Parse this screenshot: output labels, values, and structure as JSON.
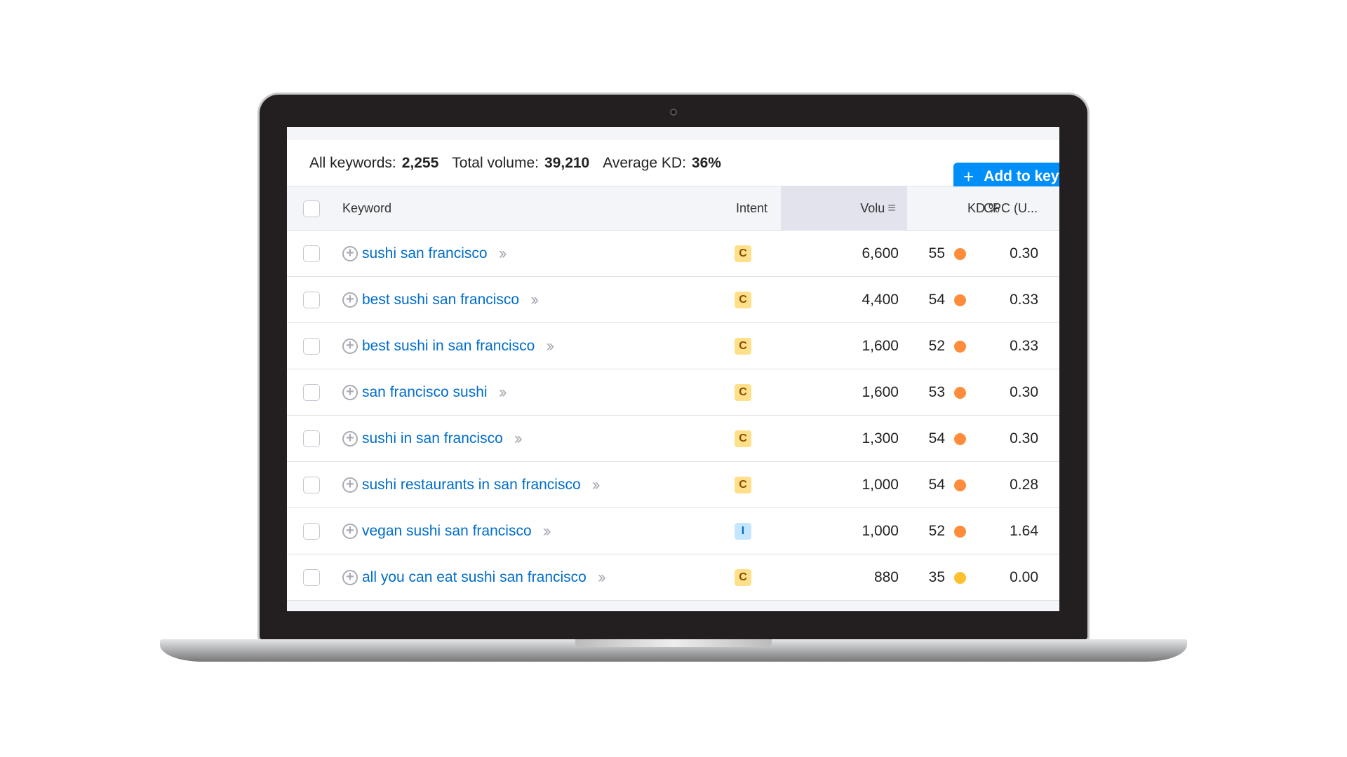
{
  "summary": {
    "all_label": "All keywords:",
    "all_value": "2,255",
    "vol_label": "Total volume:",
    "vol_value": "39,210",
    "kd_label": "Average KD:",
    "kd_value": "36%"
  },
  "add_button": {
    "icon": "plus-icon",
    "label": "Add to keyword list"
  },
  "columns": {
    "keyword": "Keyword",
    "intent": "Intent",
    "volume": "Volu",
    "kd": "KD %",
    "cpc": "CPC (U..."
  },
  "colors": {
    "link": "#006dca",
    "button": "#008ff8",
    "kd_orange": "#ff8c3b",
    "kd_yellow": "#ffc02e",
    "intent_c_bg": "#ffe08a",
    "intent_c_fg": "#8a4b00",
    "intent_i_bg": "#c5e6ff",
    "intent_i_fg": "#006dca"
  },
  "rows": [
    {
      "keyword": "sushi san francisco",
      "intent": "C",
      "volume": "6,600",
      "kd": "55",
      "kd_level": "orange",
      "cpc": "0.30"
    },
    {
      "keyword": "best sushi san francisco",
      "intent": "C",
      "volume": "4,400",
      "kd": "54",
      "kd_level": "orange",
      "cpc": "0.33"
    },
    {
      "keyword": "best sushi in san francisco",
      "intent": "C",
      "volume": "1,600",
      "kd": "52",
      "kd_level": "orange",
      "cpc": "0.33"
    },
    {
      "keyword": "san francisco sushi",
      "intent": "C",
      "volume": "1,600",
      "kd": "53",
      "kd_level": "orange",
      "cpc": "0.30"
    },
    {
      "keyword": "sushi in san francisco",
      "intent": "C",
      "volume": "1,300",
      "kd": "54",
      "kd_level": "orange",
      "cpc": "0.30"
    },
    {
      "keyword": "sushi restaurants in san francisco",
      "intent": "C",
      "volume": "1,000",
      "kd": "54",
      "kd_level": "orange",
      "cpc": "0.28"
    },
    {
      "keyword": "vegan sushi san francisco",
      "intent": "I",
      "volume": "1,000",
      "kd": "52",
      "kd_level": "orange",
      "cpc": "1.64"
    },
    {
      "keyword": "all you can eat sushi san francisco",
      "intent": "C",
      "volume": "880",
      "kd": "35",
      "kd_level": "yellow",
      "cpc": "0.00"
    }
  ]
}
